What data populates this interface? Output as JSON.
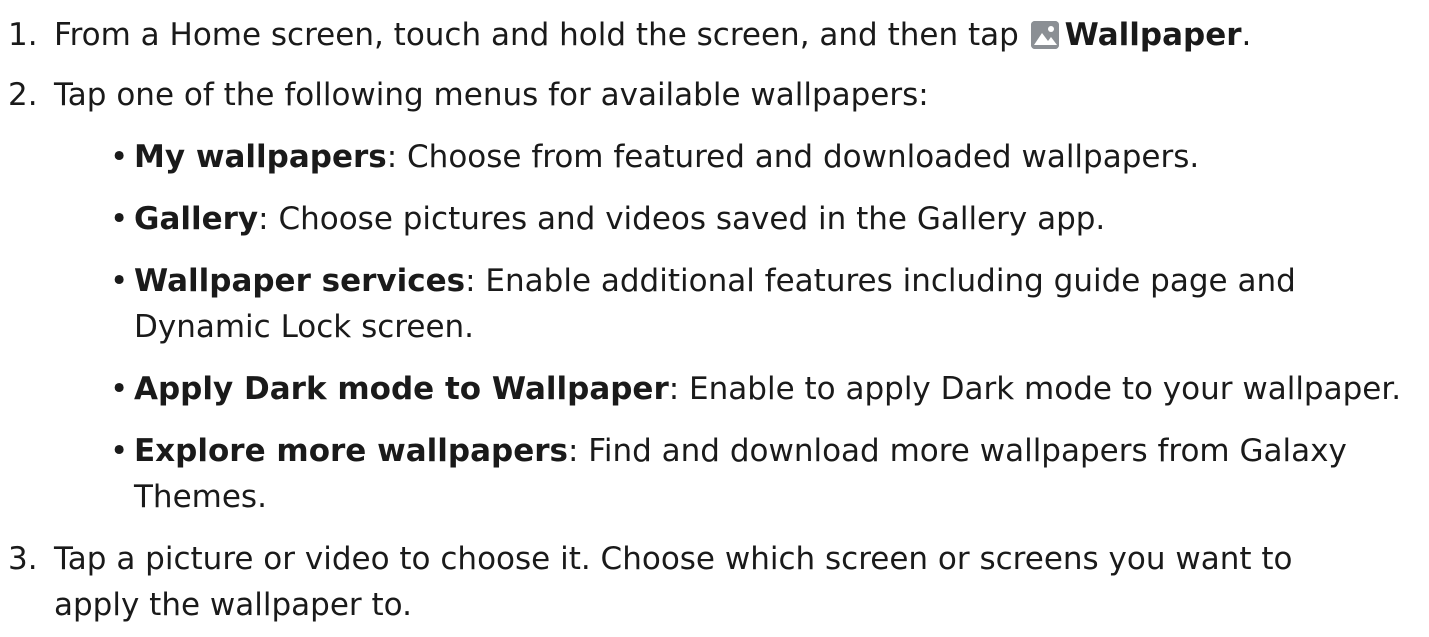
{
  "steps": [
    {
      "number": "1.",
      "text_before": "From a Home screen, touch and hold the screen, and then tap",
      "icon": "wallpaper-icon",
      "bold": "Wallpaper",
      "text_after": "."
    },
    {
      "number": "2.",
      "text": "Tap one of the following menus for available wallpapers:"
    },
    {
      "number": "3.",
      "line1": "Tap a picture or video to choose it. Choose which screen or screens you want to",
      "line2": "apply the wallpaper to."
    }
  ],
  "bullets": [
    {
      "term": "My wallpapers",
      "desc": ": Choose from featured and downloaded wallpapers."
    },
    {
      "term": "Gallery",
      "desc": ": Choose pictures and videos saved in the Gallery app."
    },
    {
      "term": "Wallpaper services",
      "desc": ": Enable additional features including guide page and",
      "desc2": "Dynamic Lock screen."
    },
    {
      "term": "Apply Dark mode to Wallpaper",
      "desc": ": Enable to apply Dark mode to your wallpaper."
    },
    {
      "term": "Explore more wallpapers",
      "desc": ": Find and download more wallpapers from Galaxy",
      "desc2": "Themes."
    }
  ],
  "bullet_char": "•"
}
